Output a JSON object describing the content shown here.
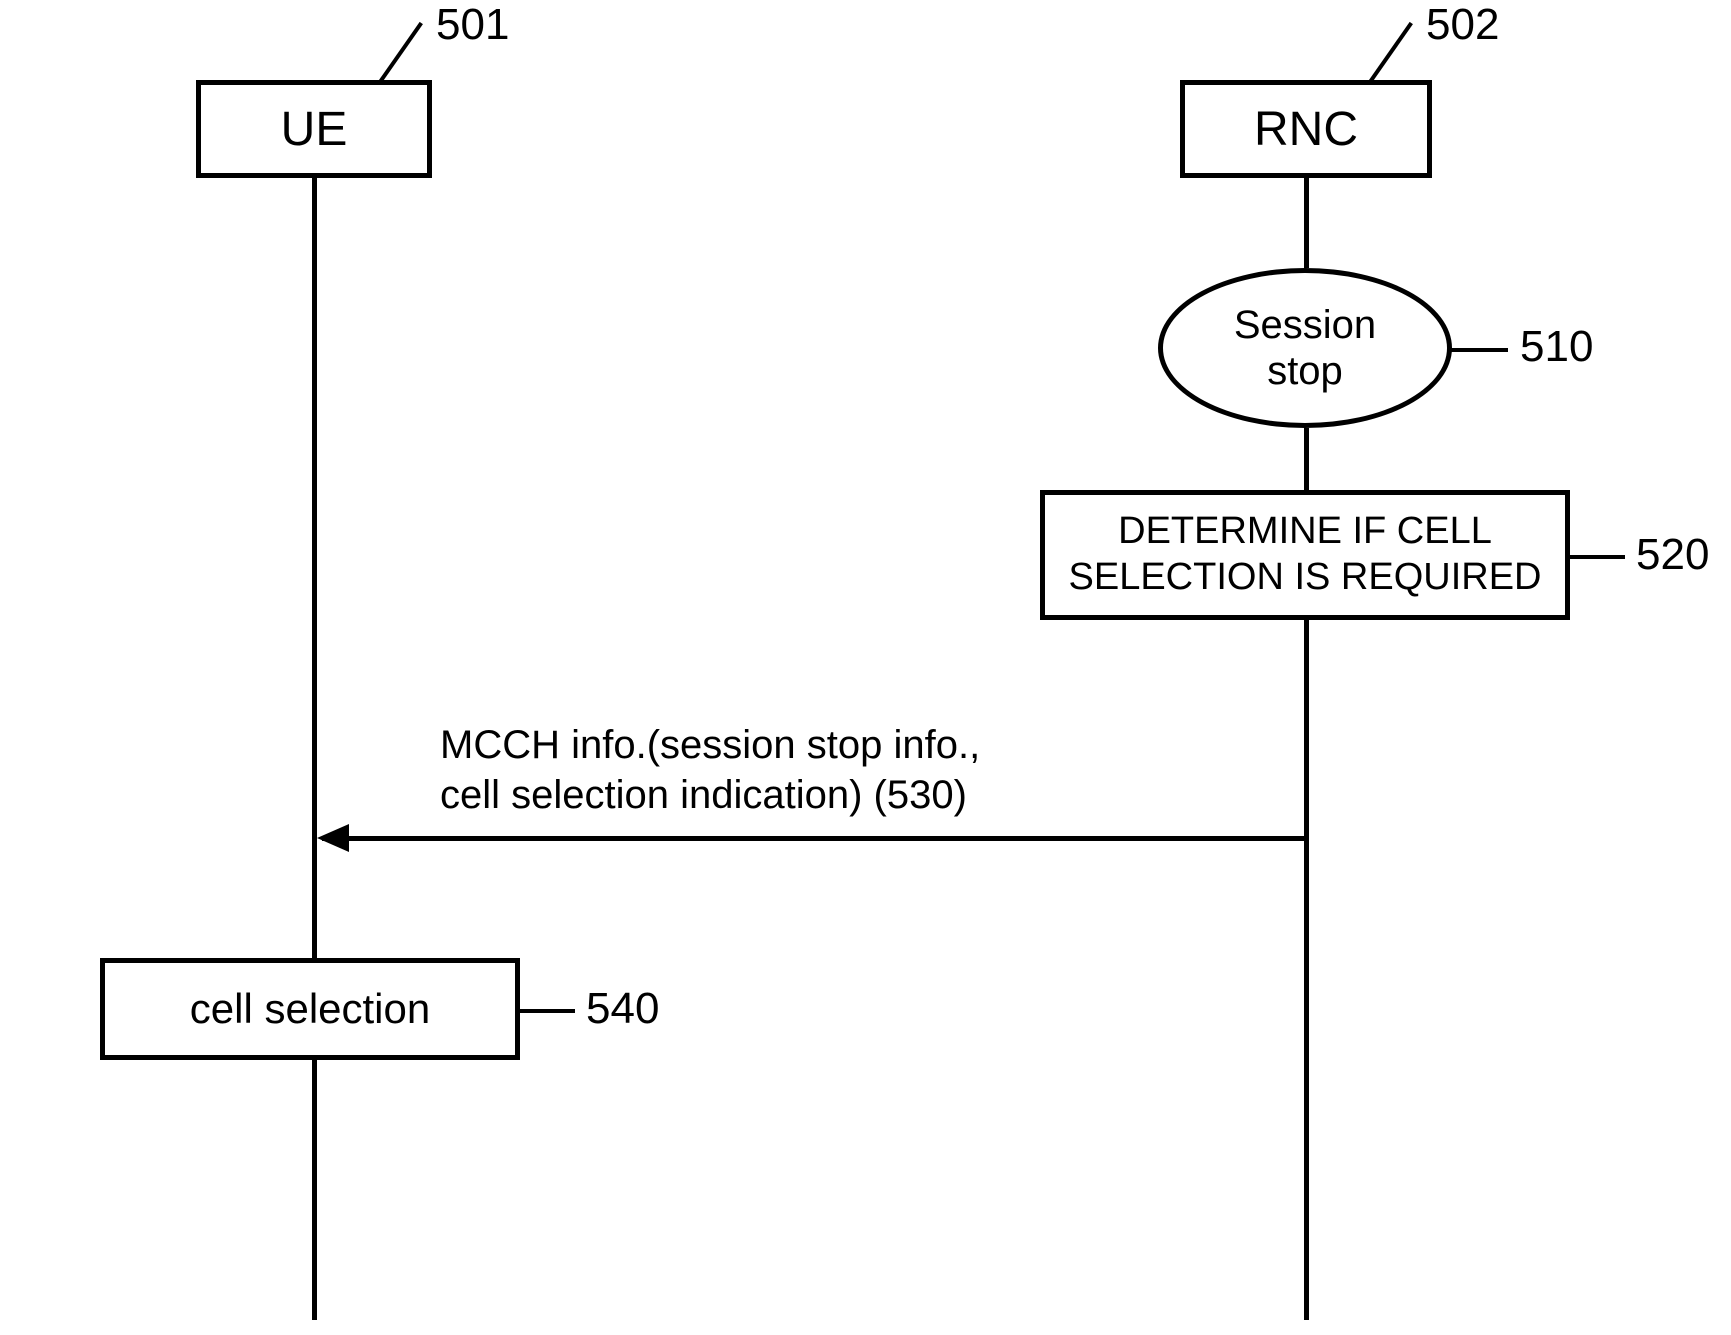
{
  "actors": {
    "ue": {
      "label": "UE",
      "ref": "501"
    },
    "rnc": {
      "label": "RNC",
      "ref": "502"
    }
  },
  "events": {
    "session_stop": {
      "label": "Session\nstop",
      "ref": "510"
    },
    "determine": {
      "label": "DETERMINE IF CELL\nSELECTION IS REQUIRED",
      "ref": "520"
    },
    "mcch_msg": {
      "label": "MCCH info.(session stop info.,\ncell selection indication) (530)"
    },
    "cell_selection": {
      "label": "cell selection",
      "ref": "540"
    }
  },
  "font_sizes": {
    "header": "48px",
    "body": "40px",
    "ref": "44px"
  }
}
